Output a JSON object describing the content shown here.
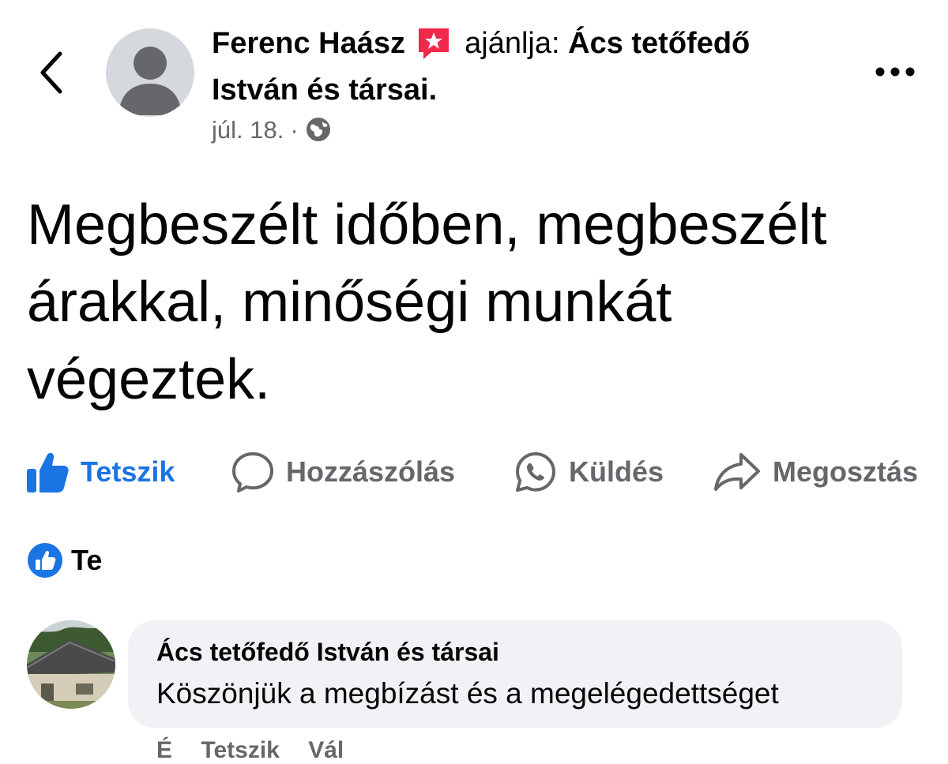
{
  "header": {
    "author_name": "Ferenc Haász",
    "recommends_text": "ajánlja:",
    "page_name_line1": "Ács tetőfedő",
    "page_name_line2": "István és társai.",
    "date": "júl. 18.",
    "separator": "·",
    "icons": {
      "back": "chevron-left-icon",
      "recommendation": "recommendation-star-icon",
      "audience": "globe-icon",
      "more": "more-options-icon"
    }
  },
  "post": {
    "text": "Megbeszélt időben, megbeszélt árakkal, minőségi munkát végeztek."
  },
  "actions": {
    "like": "Tetszik",
    "comment": "Hozzászólás",
    "send": "Küldés",
    "share": "Megosztás"
  },
  "reactions": {
    "summary": "Te"
  },
  "comment": {
    "author": "Ács tetőfedő István és társai",
    "text": "Köszönjük a megbízást és a megelégedettséget",
    "footer": {
      "time": "É",
      "like": "Tetszik",
      "reply": "Vál"
    }
  },
  "colors": {
    "accent": "#1b74e4",
    "recommendation": "#f02849",
    "secondary_text": "#65676b",
    "bubble": "#f0f2f5"
  }
}
